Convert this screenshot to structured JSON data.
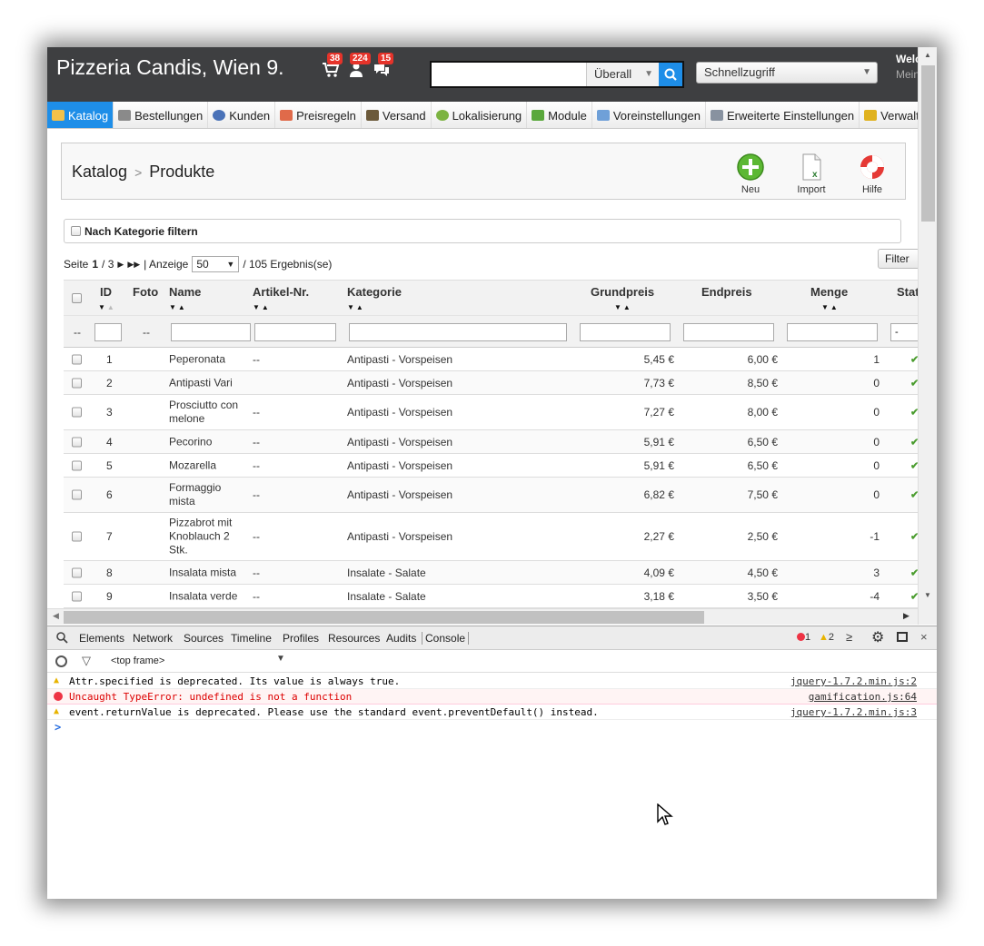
{
  "header": {
    "shop_title": "Pizzeria Candis, Wien 9.",
    "notifications": [
      {
        "icon": "cart-icon",
        "count": "38"
      },
      {
        "icon": "customers-icon",
        "count": "224"
      },
      {
        "icon": "messages-icon",
        "count": "15"
      }
    ],
    "search": {
      "value": "",
      "scope": "Überall"
    },
    "quick_access": "Schnellzugriff",
    "welcome": "Welc",
    "account": "Mein"
  },
  "nav_tabs": [
    {
      "label": "Katalog",
      "icon": "catalog-icon",
      "active": true
    },
    {
      "label": "Bestellungen",
      "icon": "orders-icon"
    },
    {
      "label": "Kunden",
      "icon": "customers-icon"
    },
    {
      "label": "Preisregeln",
      "icon": "price-rules-icon"
    },
    {
      "label": "Versand",
      "icon": "shipping-icon"
    },
    {
      "label": "Lokalisierung",
      "icon": "localization-icon"
    },
    {
      "label": "Module",
      "icon": "modules-icon"
    },
    {
      "label": "Voreinstellungen",
      "icon": "preferences-icon"
    },
    {
      "label": "Erweiterte Einstellungen",
      "icon": "advanced-settings-icon"
    },
    {
      "label": "Verwaltung",
      "icon": "administration-icon"
    }
  ],
  "page": {
    "breadcrumb": [
      "Katalog",
      "Produkte"
    ],
    "toolbar": {
      "new": "Neu",
      "import": "Import",
      "help": "Hilfe"
    },
    "category_filter": "Nach Kategorie filtern",
    "pager": {
      "prefix": "Seite",
      "current": "1",
      "total": "/ 3",
      "show": "| Anzeige",
      "page_size": "50",
      "results": "/ 105 Ergebnis(se)"
    },
    "filter_button": "Filter"
  },
  "table": {
    "columns": {
      "id": "ID",
      "photo": "Foto",
      "name": "Name",
      "article": "Artikel-Nr.",
      "category": "Kategorie",
      "base_price": "Grundpreis",
      "final_price": "Endpreis",
      "quantity": "Menge",
      "status": "Stat"
    },
    "status_filter": "-",
    "rows": [
      {
        "id": "1",
        "name": "Peperonata",
        "article": "--",
        "category": "Antipasti - Vorspeisen",
        "base": "5,45 €",
        "final": "6,00 €",
        "qty": "1"
      },
      {
        "id": "2",
        "name": "Antipasti Vari",
        "article": "",
        "category": "Antipasti - Vorspeisen",
        "base": "7,73 €",
        "final": "8,50 €",
        "qty": "0"
      },
      {
        "id": "3",
        "name": "Prosciutto con melone",
        "article": "--",
        "category": "Antipasti - Vorspeisen",
        "base": "7,27 €",
        "final": "8,00 €",
        "qty": "0"
      },
      {
        "id": "4",
        "name": "Pecorino",
        "article": "--",
        "category": "Antipasti - Vorspeisen",
        "base": "5,91 €",
        "final": "6,50 €",
        "qty": "0"
      },
      {
        "id": "5",
        "name": "Mozarella",
        "article": "--",
        "category": "Antipasti - Vorspeisen",
        "base": "5,91 €",
        "final": "6,50 €",
        "qty": "0"
      },
      {
        "id": "6",
        "name": "Formaggio mista",
        "article": "--",
        "category": "Antipasti - Vorspeisen",
        "base": "6,82 €",
        "final": "7,50 €",
        "qty": "0"
      },
      {
        "id": "7",
        "name": "Pizzabrot mit Knoblauch 2 Stk.",
        "article": "--",
        "category": "Antipasti - Vorspeisen",
        "base": "2,27 €",
        "final": "2,50 €",
        "qty": "-1"
      },
      {
        "id": "8",
        "name": "Insalata mista",
        "article": "--",
        "category": "Insalate - Salate",
        "base": "4,09 €",
        "final": "4,50 €",
        "qty": "3"
      },
      {
        "id": "9",
        "name": "Insalata verde",
        "article": "--",
        "category": "Insalate - Salate",
        "base": "3,18 €",
        "final": "3,50 €",
        "qty": "-4"
      }
    ]
  },
  "devtools": {
    "tabs": [
      "Elements",
      "Network",
      "Sources",
      "Timeline",
      "Profiles",
      "Resources",
      "Audits",
      "Console"
    ],
    "error_count": "1",
    "warning_count": "2",
    "frame": "<top frame>",
    "logs": [
      {
        "level": "warning",
        "message": "Attr.specified is deprecated. Its value is always true.",
        "source": "jquery-1.7.2.min.js:2"
      },
      {
        "level": "error",
        "message": "Uncaught TypeError: undefined is not a function",
        "source": "gamification.js:64"
      },
      {
        "level": "warning",
        "message": "event.returnValue is deprecated. Please use the standard event.preventDefault() instead.",
        "source": "jquery-1.7.2.min.js:3"
      }
    ],
    "prompt": ">"
  },
  "colors": {
    "accent": "#1e8ee8",
    "header_bg": "#3e3f41",
    "badge": "#e5332a",
    "status_ok": "#4a9c2e"
  }
}
